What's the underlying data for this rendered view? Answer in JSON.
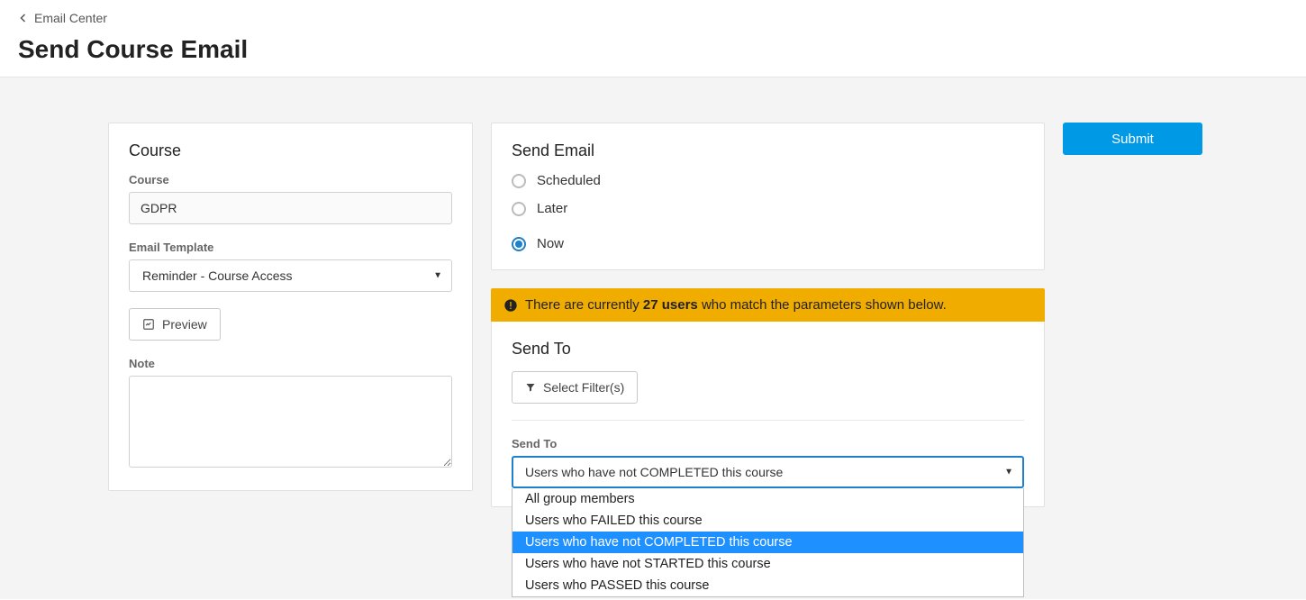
{
  "breadcrumb": {
    "label": "Email Center"
  },
  "page": {
    "title": "Send Course Email"
  },
  "coursePanel": {
    "heading": "Course",
    "courseLabel": "Course",
    "courseValue": "GDPR",
    "templateLabel": "Email Template",
    "templateValue": "Reminder - Course Access",
    "previewLabel": "Preview",
    "noteLabel": "Note",
    "noteValue": ""
  },
  "sendEmailPanel": {
    "heading": "Send Email",
    "options": [
      {
        "label": "Scheduled",
        "checked": false
      },
      {
        "label": "Later",
        "checked": false
      },
      {
        "label": "Now",
        "checked": true
      }
    ]
  },
  "alert": {
    "pre": "There are currently ",
    "count": "27 users",
    "post": " who match the parameters shown below."
  },
  "sendToPanel": {
    "heading": "Send To",
    "selectFiltersLabel": "Select Filter(s)",
    "fieldLabel": "Send To",
    "selectedValue": "Users who have not COMPLETED this course",
    "options": [
      "All group members",
      "Users who FAILED this course",
      "Users who have not COMPLETED this course",
      "Users who have not STARTED this course",
      "Users who PASSED this course"
    ],
    "highlightedIndex": 2
  },
  "submit": {
    "label": "Submit"
  }
}
